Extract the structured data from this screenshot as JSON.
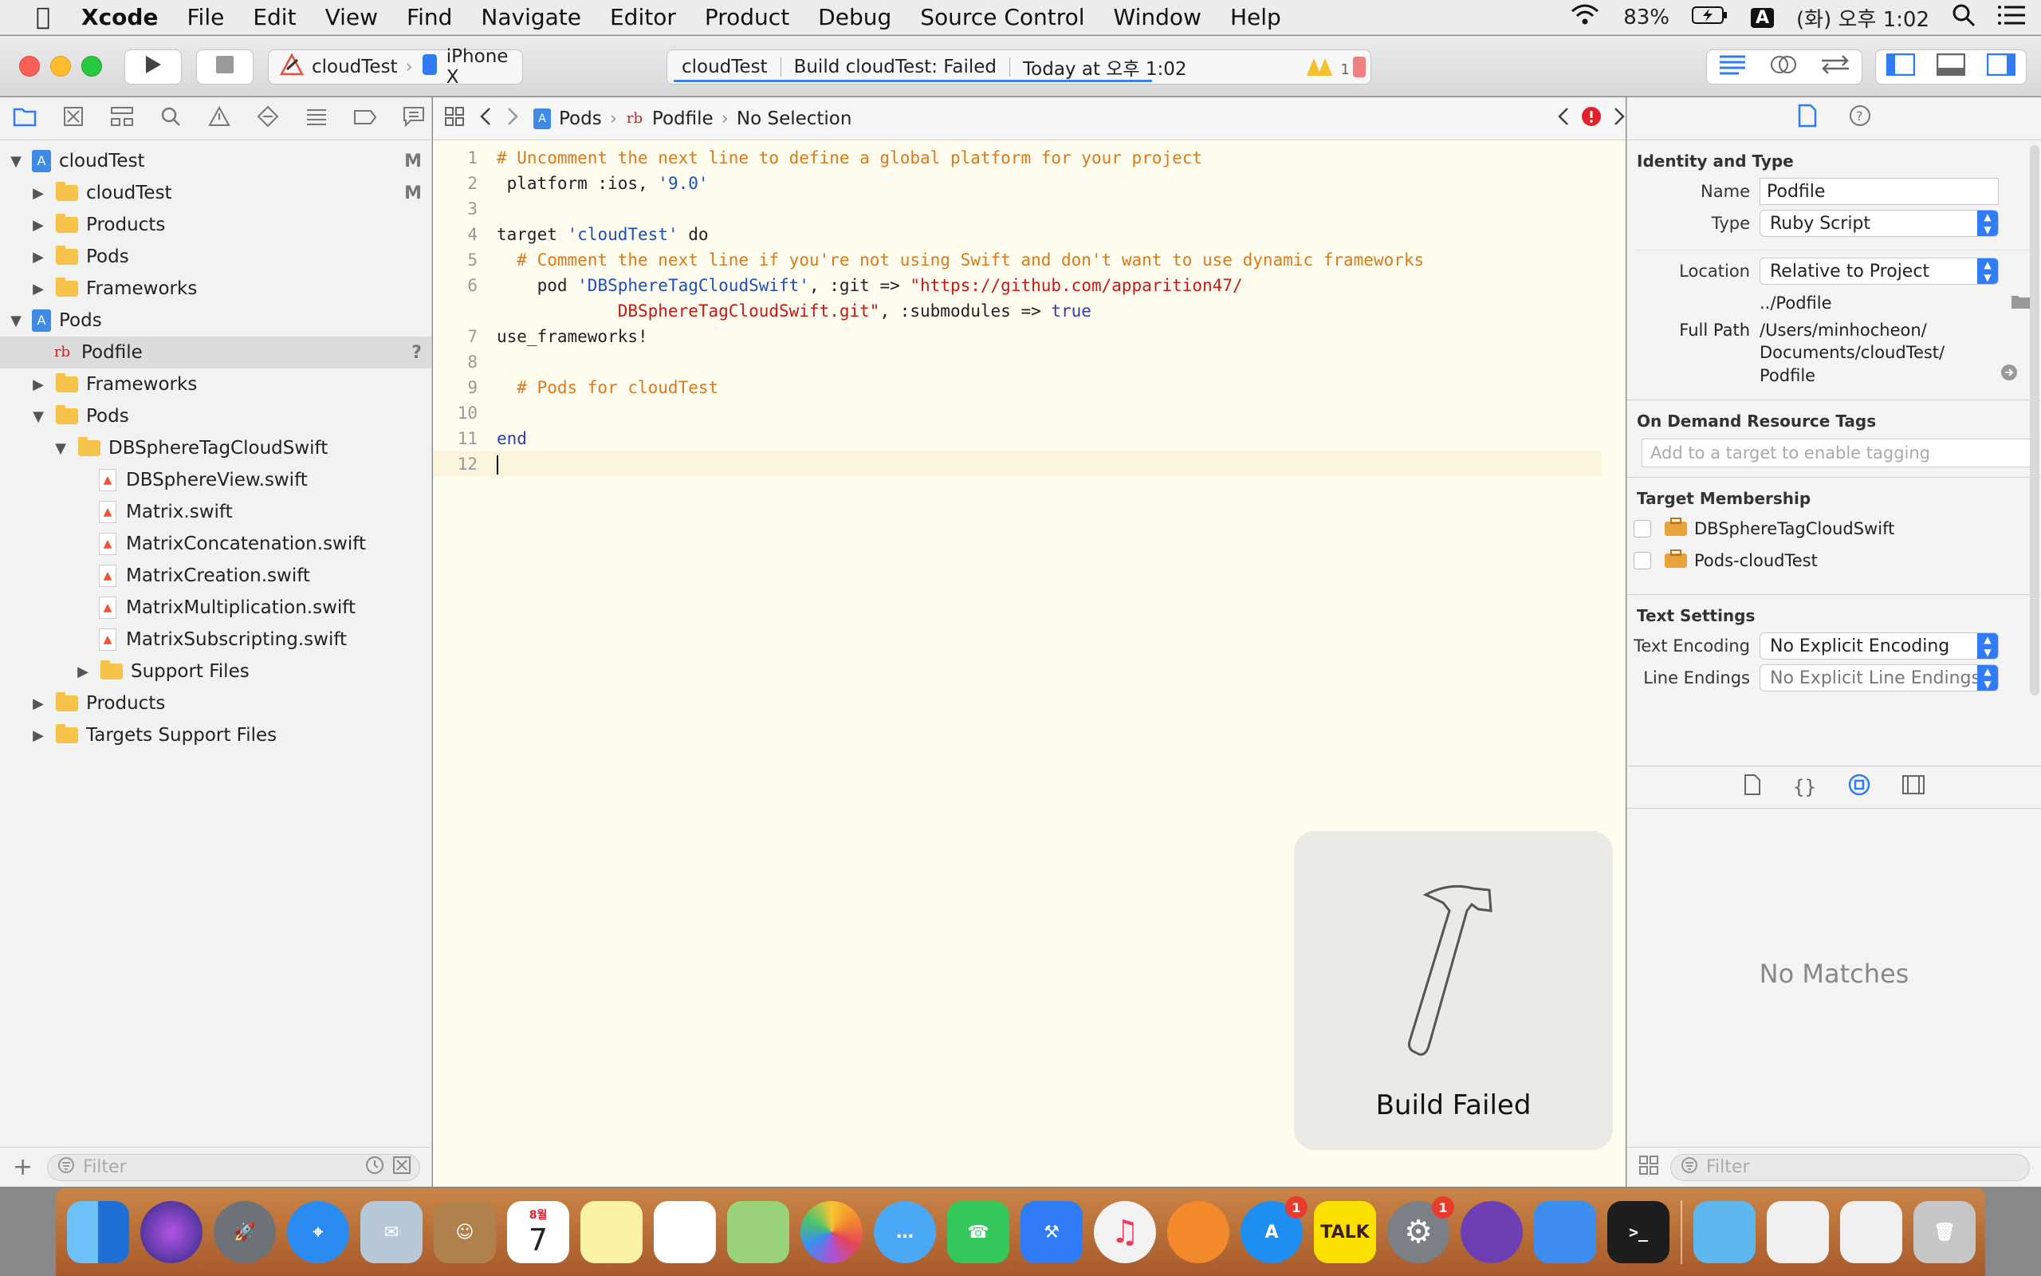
{
  "menubar": {
    "app": "Xcode",
    "items": [
      "File",
      "Edit",
      "View",
      "Find",
      "Navigate",
      "Editor",
      "Product",
      "Debug",
      "Source Control",
      "Window",
      "Help"
    ],
    "battery": "83%",
    "input_source": "A",
    "clock": "(화) 오후 1:02"
  },
  "toolbar": {
    "scheme_name": "cloudTest",
    "device": "iPhone X",
    "activity_project": "cloudTest",
    "activity_status": "Build cloudTest: Failed",
    "activity_time": "Today at 오후 1:02",
    "warning_count": "1"
  },
  "navigator": {
    "filter_placeholder": "Filter",
    "items": [
      {
        "label": "cloudTest",
        "badge": "M"
      },
      {
        "label": "cloudTest",
        "badge": "M"
      },
      {
        "label": "Products",
        "badge": ""
      },
      {
        "label": "Pods",
        "badge": ""
      },
      {
        "label": "Frameworks",
        "badge": ""
      },
      {
        "label": "Pods",
        "badge": ""
      },
      {
        "label": "Podfile",
        "badge": "?"
      },
      {
        "label": "Frameworks",
        "badge": ""
      },
      {
        "label": "Pods",
        "badge": ""
      },
      {
        "label": "DBSphereTagCloudSwift",
        "badge": ""
      },
      {
        "label": "DBSphereView.swift",
        "badge": ""
      },
      {
        "label": "Matrix.swift",
        "badge": ""
      },
      {
        "label": "MatrixConcatenation.swift",
        "badge": ""
      },
      {
        "label": "MatrixCreation.swift",
        "badge": ""
      },
      {
        "label": "MatrixMultiplication.swift",
        "badge": ""
      },
      {
        "label": "MatrixSubscripting.swift",
        "badge": ""
      },
      {
        "label": "Support Files",
        "badge": ""
      },
      {
        "label": "Products",
        "badge": ""
      },
      {
        "label": "Targets Support Files",
        "badge": ""
      }
    ]
  },
  "jumpbar": {
    "crumb1": "Pods",
    "crumb2": "Podfile",
    "crumb3": "No Selection"
  },
  "code": {
    "lines": [
      {
        "n": "1",
        "parts": [
          {
            "t": "# Uncomment the next line to define a global platform for your project",
            "c": "cm"
          }
        ]
      },
      {
        "n": "2",
        "parts": [
          {
            "t": " platform :ios, ",
            "c": ""
          },
          {
            "t": "'9.0'",
            "c": "str2"
          }
        ]
      },
      {
        "n": "3",
        "parts": []
      },
      {
        "n": "4",
        "parts": [
          {
            "t": "target ",
            "c": ""
          },
          {
            "t": "'cloudTest'",
            "c": "str2"
          },
          {
            "t": " do",
            "c": ""
          }
        ]
      },
      {
        "n": "5",
        "parts": [
          {
            "t": "  # Comment the next line if you're not using Swift and don't want to use dynamic frameworks",
            "c": "cm"
          }
        ]
      },
      {
        "n": "6",
        "parts": [
          {
            "t": "    pod ",
            "c": ""
          },
          {
            "t": "'DBSphereTagCloudSwift'",
            "c": "str2"
          },
          {
            "t": ", :git => ",
            "c": ""
          },
          {
            "t": "\"https://github.com/apparition47/",
            "c": "st"
          }
        ]
      },
      {
        "n": "",
        "parts": [
          {
            "t": "            DBSphereTagCloudSwift.git\"",
            "c": "st"
          },
          {
            "t": ", :submodules => ",
            "c": ""
          },
          {
            "t": "true",
            "c": "kw"
          }
        ]
      },
      {
        "n": "7",
        "parts": [
          {
            "t": "use_frameworks!",
            "c": ""
          }
        ]
      },
      {
        "n": "8",
        "parts": []
      },
      {
        "n": "9",
        "parts": [
          {
            "t": "  # Pods for cloudTest",
            "c": "cm"
          }
        ]
      },
      {
        "n": "10",
        "parts": []
      },
      {
        "n": "11",
        "parts": [
          {
            "t": "end",
            "c": "kw"
          }
        ]
      },
      {
        "n": "12",
        "parts": []
      }
    ]
  },
  "popup": {
    "text": "Build Failed"
  },
  "inspector": {
    "identity_header": "Identity and Type",
    "name_label": "Name",
    "name_value": "Podfile",
    "type_label": "Type",
    "type_value": "Ruby Script",
    "location_label": "Location",
    "location_value": "Relative to Project",
    "relative_path": "../Podfile",
    "fullpath_label": "Full Path",
    "fullpath_1": "/Users/minhocheon/",
    "fullpath_2": "Documents/cloudTest/",
    "fullpath_3": "Podfile",
    "odr_header": "On Demand Resource Tags",
    "odr_placeholder": "Add to a target to enable tagging",
    "membership_header": "Target Membership",
    "targets": [
      "DBSphereTagCloudSwift",
      "Pods-cloudTest"
    ],
    "text_settings_header": "Text Settings",
    "encoding_label": "Text Encoding",
    "encoding_value": "No Explicit Encoding",
    "endings_label": "Line Endings",
    "endings_value": "No Explicit Line Endings",
    "no_matches": "No Matches",
    "filter_placeholder": "Filter"
  },
  "dock": {
    "calendar_month": "8월",
    "calendar_day": "7",
    "talk_label": "TALK",
    "appstore_badge": "1",
    "prefs_badge": "1"
  },
  "colors": {
    "accent": "#2f7cf6",
    "error": "#e0202a",
    "comment": "#d77b1c",
    "string": "#c41a16"
  }
}
